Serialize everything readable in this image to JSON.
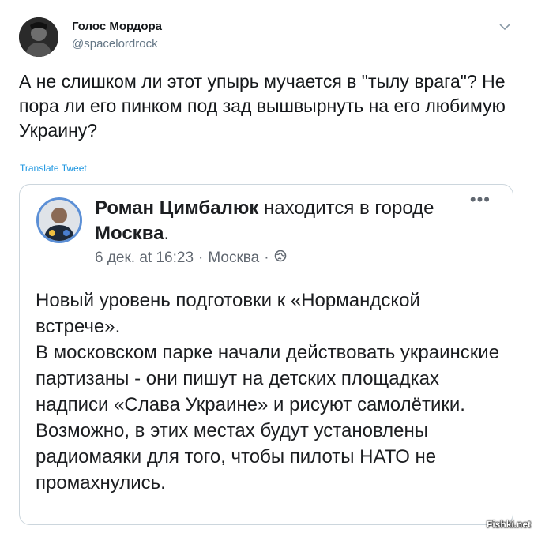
{
  "tweet": {
    "author_name": "Голос Мордора",
    "author_handle": "@spacelordrock",
    "text": "А не слишком ли этот упырь мучается в \"тылу врага\"? Не пора ли его пинком под зад вышвырнуть на его любимую Украину?",
    "translate_label": "Translate Tweet",
    "menu_icon": "chevron-down-icon"
  },
  "embedded_post": {
    "author_name": "Роман Цимбалюк",
    "status_text": "находится в городе",
    "city": "Москва",
    "status_end": ".",
    "date": "6 дек. at 16:23",
    "separator": "·",
    "location": "Москва",
    "privacy_icon": "globe-icon",
    "more_label": "•••",
    "body_lines": [
      "Новый уровень подготовки к «Нормандской встрече».",
      "В московском парке начали действовать украинские партизаны - они пишут на детских площадках надписи «Слава Украине» и рисуют самолётики.",
      "Возможно, в этих местах будут установлены радиомаяки для того, чтобы пилоты НАТО не промахнулись."
    ]
  },
  "watermark": "Fishki.net",
  "colors": {
    "link": "#1b95e0",
    "muted": "#657786",
    "border": "#ccd6dd"
  }
}
